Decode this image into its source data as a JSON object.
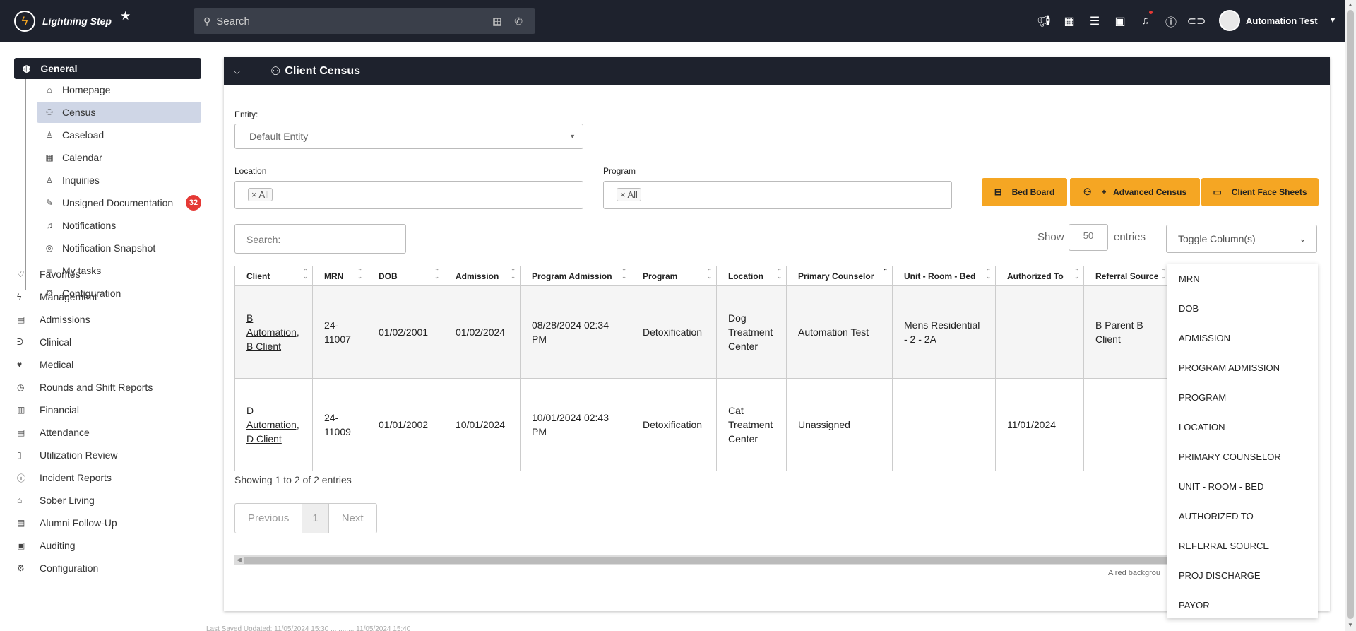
{
  "app": {
    "name": "Lightning Step"
  },
  "search": {
    "placeholder": "Search"
  },
  "user": {
    "name": "Automation Test"
  },
  "sidebar": {
    "section": "General",
    "items": [
      {
        "label": "Homepage",
        "icon": "home-icon",
        "glyph": "⌂"
      },
      {
        "label": "Census",
        "icon": "users-icon",
        "glyph": "⚇"
      },
      {
        "label": "Caseload",
        "icon": "user-icon",
        "glyph": "♙"
      },
      {
        "label": "Calendar",
        "icon": "calendar-icon",
        "glyph": "▦"
      },
      {
        "label": "Inquiries",
        "icon": "user-question-icon",
        "glyph": "♙"
      },
      {
        "label": "Unsigned Documentation",
        "icon": "pen-icon",
        "glyph": "✎",
        "badge": "32"
      },
      {
        "label": "Notifications",
        "icon": "bell-icon",
        "glyph": "♫"
      },
      {
        "label": "Notification Snapshot",
        "icon": "clock-icon",
        "glyph": "◎"
      },
      {
        "label": "My tasks",
        "icon": "tasks-icon",
        "glyph": "≡"
      },
      {
        "label": "Configuration",
        "icon": "gear-icon",
        "glyph": "⚙"
      }
    ],
    "sections": [
      {
        "label": "Favorites",
        "icon": "heart-icon",
        "glyph": "♡"
      },
      {
        "label": "Management",
        "icon": "bolt-icon",
        "glyph": "ϟ"
      },
      {
        "label": "Admissions",
        "icon": "clipboard-icon",
        "glyph": "▤"
      },
      {
        "label": "Clinical",
        "icon": "stethoscope-icon",
        "glyph": "ᕭ"
      },
      {
        "label": "Medical",
        "icon": "heartbeat-icon",
        "glyph": "♥"
      },
      {
        "label": "Rounds and Shift Reports",
        "icon": "clock-icon",
        "glyph": "◷"
      },
      {
        "label": "Financial",
        "icon": "receipt-icon",
        "glyph": "▥"
      },
      {
        "label": "Attendance",
        "icon": "list-icon",
        "glyph": "▤"
      },
      {
        "label": "Utilization Review",
        "icon": "document-icon",
        "glyph": "▯"
      },
      {
        "label": "Incident Reports",
        "icon": "alert-icon",
        "glyph": "ⓘ"
      },
      {
        "label": "Sober Living",
        "icon": "house-icon",
        "glyph": "⌂"
      },
      {
        "label": "Alumni Follow-Up",
        "icon": "list-icon",
        "glyph": "▤"
      },
      {
        "label": "Auditing",
        "icon": "audit-icon",
        "glyph": "▣"
      },
      {
        "label": "Configuration",
        "icon": "gear-icon",
        "glyph": "⚙"
      }
    ]
  },
  "panel": {
    "title": "Client Census"
  },
  "filters": {
    "entity_label": "Entity:",
    "entity_value": "Default Entity",
    "location_label": "Location",
    "location_tag": "× All",
    "program_label": "Program",
    "program_tag": "× All"
  },
  "buttons": {
    "bed_board": "Bed Board",
    "advanced_census": "+   Advanced Census",
    "face_sheets": "Client Face Sheets"
  },
  "table_controls": {
    "search_placeholder": "Search:",
    "show": "Show",
    "entries_value": "50",
    "entries": "entries",
    "toggle": "Toggle Column(s)"
  },
  "table": {
    "headers": [
      "Client",
      "MRN",
      "DOB",
      "Admission",
      "Program Admission",
      "Program",
      "Location",
      "Primary Counselor",
      "Unit - Room - Bed",
      "Authorized To",
      "Referral Source"
    ],
    "rows": [
      {
        "client": "B Automation, B Client",
        "mrn": "24-11007",
        "dob": "01/02/2001",
        "admission": "01/02/2024",
        "program_admission": "08/28/2024 02:34 PM",
        "program": "Detoxification",
        "location": "Dog Treatment Center",
        "counselor": "Automation Test",
        "unit": "Mens Residential - 2 - 2A",
        "authorized": "",
        "referral": "B Parent B Client"
      },
      {
        "client": "D Automation, D Client",
        "mrn": "24-11009",
        "dob": "01/01/2002",
        "admission": "10/01/2024",
        "program_admission": "10/01/2024 02:43 PM",
        "program": "Detoxification",
        "location": "Cat Treatment Center",
        "counselor": "Unassigned",
        "unit": "",
        "authorized": "11/01/2024",
        "referral": ""
      }
    ]
  },
  "info": "Showing 1 to 2 of 2 entries",
  "pager": {
    "prev": "Previous",
    "page": "1",
    "next": "Next"
  },
  "note": "A red backgrou",
  "toggle_options": [
    "MRN",
    "DOB",
    "ADMISSION",
    "PROGRAM ADMISSION",
    "PROGRAM",
    "LOCATION",
    "PRIMARY COUNSELOR",
    "UNIT - ROOM - BED",
    "AUTHORIZED TO",
    "REFERRAL SOURCE",
    "PROJ DISCHARGE",
    "PAYOR"
  ],
  "footer": "Last Saved Updated: 11/05/2024 15:30   ...  ........  11/05/2024 15:40"
}
